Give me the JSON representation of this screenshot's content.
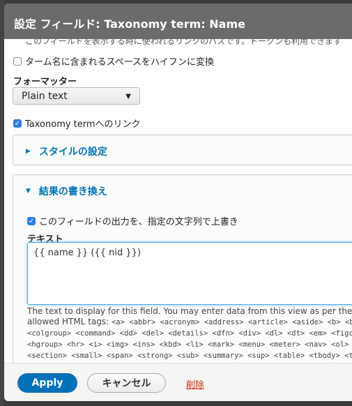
{
  "dialog": {
    "title": "設定 フィールド: Taxonomy term: Name"
  },
  "body": {
    "cut_text": "このフィールドを表示する時に使われるリンクのパスです。トークンも利用できます",
    "hyphen_checkbox": {
      "label": "ターム名に含まれるスペースをハイフンに変換",
      "checked": false
    },
    "formatter": {
      "label": "フォーマッター",
      "value": "Plain text"
    },
    "link_checkbox": {
      "label": "Taxonomy termへのリンク",
      "checked": true
    },
    "style_settings": {
      "label": "スタイルの設定",
      "expanded": false
    },
    "rewrite": {
      "label": "結果の書き換え",
      "expanded": true,
      "override_checkbox": {
        "label": "このフィールドの出力を、指定の文字列で上書き",
        "checked": true
      },
      "text_label": "テキスト",
      "text_value": "{{ name }} ({{ nid }})",
      "desc_line1": "The text to display for this field. You may enter data from this view as per the",
      "desc_prefix": "allowed HTML tags: ",
      "tags1": "<a> <abbr> <acronym> <address> <article> <aside> <b> <bdi>",
      "tags2": "<colgroup> <command> <dd> <del> <details> <dfn> <div> <dl> <dt> <em> <figcaption>",
      "tags3": "<hgroup> <hr> <i> <img> <ins> <kbd> <li> <mark> <menu> <meter> <nav> <ol> <output>",
      "tags4": "<section> <small> <span> <strong> <sub> <summary> <sup> <table> <tbody> <td>"
    }
  },
  "footer": {
    "apply": "Apply",
    "cancel": "キャンセル",
    "delete": "削除"
  },
  "colors": {
    "accent": "#0071b8",
    "link": "#0073b6",
    "delete": "#d0270a",
    "titlebar": "#6b6b6b"
  }
}
